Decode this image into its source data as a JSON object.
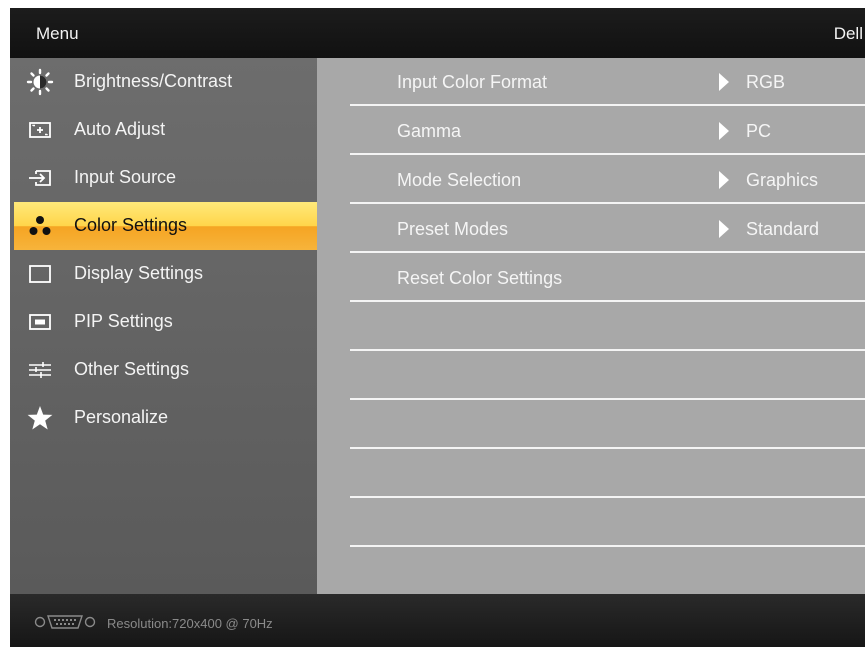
{
  "header": {
    "title": "Menu",
    "brand": "Dell"
  },
  "sidebar": {
    "items": [
      {
        "label": "Brightness/Contrast",
        "icon": "brightness-icon"
      },
      {
        "label": "Auto Adjust",
        "icon": "auto-adjust-icon"
      },
      {
        "label": "Input Source",
        "icon": "input-source-icon"
      },
      {
        "label": "Color Settings",
        "icon": "color-settings-icon",
        "selected": true
      },
      {
        "label": "Display Settings",
        "icon": "display-settings-icon"
      },
      {
        "label": "PIP Settings",
        "icon": "pip-settings-icon"
      },
      {
        "label": "Other Settings",
        "icon": "other-settings-icon"
      },
      {
        "label": "Personalize",
        "icon": "star-icon"
      }
    ]
  },
  "content": {
    "rows": [
      {
        "label": "Input Color Format",
        "value": "RGB"
      },
      {
        "label": "Gamma",
        "value": "PC"
      },
      {
        "label": "Mode Selection",
        "value": "Graphics"
      },
      {
        "label": "Preset Modes",
        "value": "Standard"
      },
      {
        "label": "Reset Color Settings",
        "value": ""
      },
      {
        "label": "",
        "value": ""
      },
      {
        "label": "",
        "value": ""
      },
      {
        "label": "",
        "value": ""
      },
      {
        "label": "",
        "value": ""
      },
      {
        "label": "",
        "value": ""
      }
    ]
  },
  "footer": {
    "resolution": "Resolution:720x400 @ 70Hz",
    "connector_icon": "vga-connector-icon"
  },
  "colors": {
    "selected_top": "#ffe97a",
    "selected_bottom": "#f5a423",
    "panel": "#a8a8a8",
    "sidebar": "#636363"
  }
}
